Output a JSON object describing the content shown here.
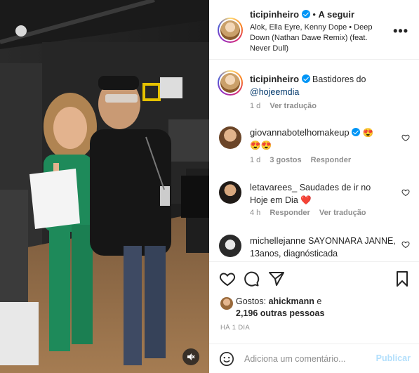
{
  "header": {
    "username": "ticipinheiro",
    "separator": "•",
    "follow_label": "A seguir",
    "music": "Alok, Ella Eyre, Kenny Dope • Deep Down (Nathan Dawe Remix) (feat. Never Dull)",
    "more_label": "•••"
  },
  "caption": {
    "username": "ticipinheiro",
    "text": "Bastidores do",
    "mention": "@hojeemdia",
    "time": "1 d",
    "translate": "Ver tradução"
  },
  "comments": [
    {
      "username": "giovannabotelhomakeup",
      "emoji_inline": "😍",
      "text": "😍😍",
      "time": "1 d",
      "likes": "3 gostos",
      "reply": "Responder"
    },
    {
      "username": "letavarees_",
      "text": "Saudades de ir no Hoje em Dia",
      "emoji": "❤️",
      "time": "4 h",
      "reply": "Responder",
      "translate": "Ver tradução"
    },
    {
      "username": "michellejanne",
      "text": "SAYONNARA JANNE, 13anos, diagnósticada"
    }
  ],
  "likes": {
    "prefix": "Gostos:",
    "user": "ahickmann",
    "suffix": "e",
    "others": "2,196 outras pessoas"
  },
  "date": "HÁ 1 DIA",
  "composer": {
    "placeholder": "Adiciona um comentário...",
    "publish": "Publicar"
  },
  "icons": {
    "like": "heart-icon",
    "comment": "comment-icon",
    "share": "send-icon",
    "save": "bookmark-icon",
    "mute": "muted-speaker-icon",
    "emoji": "smiley-icon"
  },
  "colors": {
    "verified": "#0095f6",
    "publish_disabled": "#b2dffc",
    "like_red": "#ed4956",
    "muted_text": "#8e8e8e"
  }
}
